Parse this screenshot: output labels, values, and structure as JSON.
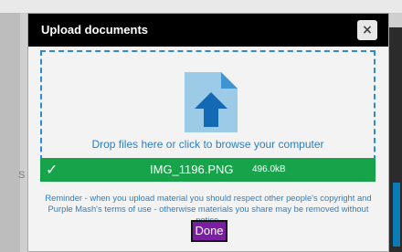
{
  "modal": {
    "title": "Upload documents",
    "close_label": "×"
  },
  "dropzone": {
    "text": "Drop files here or click to browse your computer",
    "icon": "document-upload-icon"
  },
  "file": {
    "status_icon": "✓",
    "name": "IMG_1196.PNG",
    "size": "496.0kB"
  },
  "reminder": "Reminder - when you upload material you should respect other people's copyright and Purple Mash's terms of use - otherwise materials you share may be removed without notice.",
  "done_label": "Done",
  "background": {
    "visible_letter": "S"
  },
  "colors": {
    "header": "#000000",
    "accent_blue": "#2c7ec4",
    "success_green": "#16a34a",
    "done_purple": "#7b1fa2"
  }
}
